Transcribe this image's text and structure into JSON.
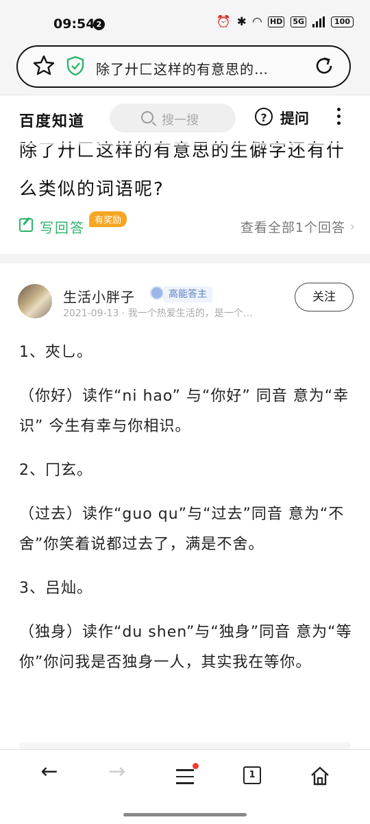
{
  "status_bar": {
    "time": "09:54",
    "notification_count": "2",
    "network_hd": "HD",
    "network_5g": "5G",
    "battery": "100"
  },
  "browser": {
    "address_text": "除了廾匚这样的有意思的…",
    "icons": [
      "star-icon",
      "shield-check-icon",
      "refresh-icon"
    ]
  },
  "header": {
    "logo": "百度知道",
    "search_placeholder": "搜一搜",
    "ask_label": "提问"
  },
  "question": {
    "title": "除了廾匚这样的有意思的生僻字还有什么类似的词语呢?",
    "write_answer": "写回答",
    "reward_badge": "有奖励",
    "view_all": "查看全部1个回答"
  },
  "answer": {
    "author": "生活小胖子",
    "author_badge": "高能答主",
    "meta": "2021-09-13 · 我一个热爱生活的，是一个…",
    "follow_label": "关注",
    "paragraphs": [
      "1、夾乚。",
      "（你好）读作“ni hao” 与“你好” 同音 意为“幸识” 今生有幸与你相识。",
      "2、冂玄。",
      "（过去）读作“guo qu”与“过去”同音 意为“不舍”你笑着说都过去了，满是不舍。",
      "3、吕灿。",
      "（独身）读作“du shen”与“独身”同音 意为“等你”你问我是否独身一人，其实我在等你。"
    ]
  },
  "bottom_nav": {
    "tabs_count": "1",
    "items": [
      "back-arrow-icon",
      "forward-arrow-icon",
      "menu-icon",
      "tabs-icon",
      "home-icon"
    ],
    "menu_dot_color": "#f03c2e"
  },
  "colors": {
    "accent_green": "#2db36a",
    "reward_orange": "#f6a623",
    "badge_blue": "#5b7fc4"
  }
}
